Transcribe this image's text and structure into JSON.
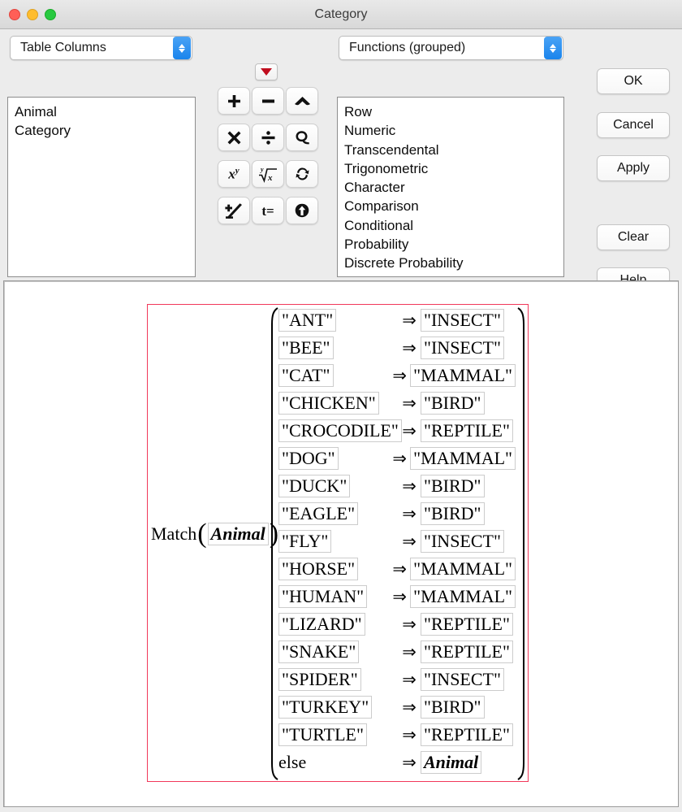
{
  "window": {
    "title": "Category",
    "traffic_lights": [
      "close",
      "minimize",
      "maximize"
    ]
  },
  "source_popup": {
    "label": "Table Columns",
    "icon": "stepper-updown-icon"
  },
  "functions_popup": {
    "label": "Functions (grouped)",
    "icon": "stepper-updown-icon"
  },
  "columns_list": {
    "items": [
      "Animal",
      "Category"
    ]
  },
  "functions_list": {
    "items": [
      "Row",
      "Numeric",
      "Transcendental",
      "Trigonometric",
      "Character",
      "Comparison",
      "Conditional",
      "Probability",
      "Discrete Probability"
    ]
  },
  "keypad": {
    "dropdown_icon": "red-triangle-down-icon",
    "buttons": [
      {
        "icon": "plus-icon",
        "label": "+"
      },
      {
        "icon": "minus-icon",
        "label": "−"
      },
      {
        "icon": "caret-up-icon",
        "label": "^"
      },
      {
        "icon": "multiply-icon",
        "label": "×"
      },
      {
        "icon": "divide-icon",
        "label": "÷"
      },
      {
        "icon": "lasso-icon",
        "label": "Q"
      },
      {
        "icon": "power-xy-icon",
        "label": "xʸ"
      },
      {
        "icon": "nth-root-icon",
        "label": "ʸ√x"
      },
      {
        "icon": "swap-arrows-icon",
        "label": "↻"
      },
      {
        "icon": "plus-minus-icon",
        "label": "±"
      },
      {
        "icon": "t-equals-icon",
        "label": "t="
      },
      {
        "icon": "insert-arrow-icon",
        "label": "⬆"
      }
    ]
  },
  "actions": {
    "ok": "OK",
    "cancel": "Cancel",
    "apply": "Apply",
    "clear": "Clear",
    "help": "Help"
  },
  "formula": {
    "function_name": "Match",
    "bracket_open": "⎛",
    "bracket_close": "⎞",
    "argument": "Animal",
    "arrow": "⇒",
    "else_label": "else",
    "else_value": "Animal",
    "rows": [
      {
        "match": "\"ANT\"",
        "result": "\"INSECT\""
      },
      {
        "match": "\"BEE\"",
        "result": "\"INSECT\""
      },
      {
        "match": "\"CAT\"",
        "result": "\"MAMMAL\""
      },
      {
        "match": "\"CHICKEN\"",
        "result": "\"BIRD\""
      },
      {
        "match": "\"CROCODILE\"",
        "result": "\"REPTILE\""
      },
      {
        "match": "\"DOG\"",
        "result": "\"MAMMAL\""
      },
      {
        "match": "\"DUCK\"",
        "result": "\"BIRD\""
      },
      {
        "match": "\"EAGLE\"",
        "result": "\"BIRD\""
      },
      {
        "match": "\"FLY\"",
        "result": "\"INSECT\""
      },
      {
        "match": "\"HORSE\"",
        "result": "\"MAMMAL\""
      },
      {
        "match": "\"HUMAN\"",
        "result": "\"MAMMAL\""
      },
      {
        "match": "\"LIZARD\"",
        "result": "\"REPTILE\""
      },
      {
        "match": "\"SNAKE\"",
        "result": "\"REPTILE\""
      },
      {
        "match": "\"SPIDER\"",
        "result": "\"INSECT\""
      },
      {
        "match": "\"TURKEY\"",
        "result": "\"BIRD\""
      },
      {
        "match": "\"TURTLE\"",
        "result": "\"REPTILE\""
      }
    ]
  },
  "colors": {
    "window_bg": "#ececec",
    "accent_blue": "#1a84ec",
    "expr_border_red": "#f1385a",
    "dropdown_red": "#c00d1e",
    "close": "#ff5f57",
    "minimize": "#ffbd2e",
    "maximize": "#28c940"
  }
}
